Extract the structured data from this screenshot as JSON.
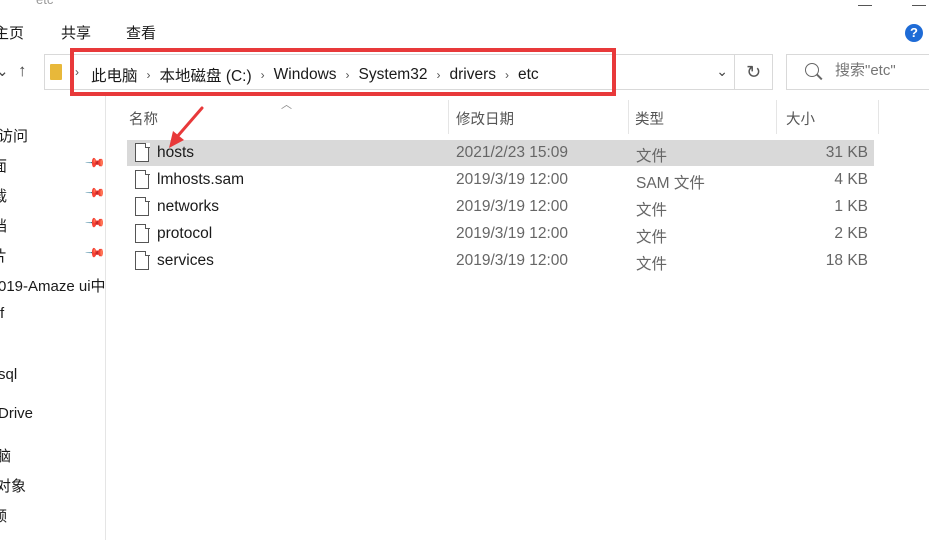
{
  "window": {
    "title": "etc"
  },
  "ribbon": {
    "tabs": [
      "主页",
      "共享",
      "查看"
    ]
  },
  "address": {
    "crumbs": [
      "此电脑",
      "本地磁盘 (C:)",
      "Windows",
      "System32",
      "drivers",
      "etc"
    ]
  },
  "search": {
    "placeholder": "搜索\"etc\""
  },
  "sidebar": {
    "items": [
      "访问",
      "面",
      "载",
      "档",
      "片",
      "019-Amaze ui中",
      "f",
      "sql",
      "Drive",
      "脑",
      "对象",
      "频"
    ]
  },
  "columns": {
    "name": "名称",
    "date": "修改日期",
    "type": "类型",
    "size": "大小"
  },
  "files": [
    {
      "name": "hosts",
      "date": "2021/2/23 15:09",
      "type": "文件",
      "size": "31 KB",
      "selected": true
    },
    {
      "name": "lmhosts.sam",
      "date": "2019/3/19 12:00",
      "type": "SAM 文件",
      "size": "4 KB",
      "selected": false
    },
    {
      "name": "networks",
      "date": "2019/3/19 12:00",
      "type": "文件",
      "size": "1 KB",
      "selected": false
    },
    {
      "name": "protocol",
      "date": "2019/3/19 12:00",
      "type": "文件",
      "size": "2 KB",
      "selected": false
    },
    {
      "name": "services",
      "date": "2019/3/19 12:00",
      "type": "文件",
      "size": "18 KB",
      "selected": false
    }
  ],
  "colors": {
    "highlight": "#e8393a",
    "selected_row": "#d9d9d9",
    "folder": "#e8b83a"
  },
  "icons": [
    "back-icon",
    "up-icon",
    "folder-icon",
    "chevron-right-icon",
    "dropdown-icon",
    "refresh-icon",
    "search-icon",
    "pin-icon",
    "file-icon",
    "red-arrow-annotation"
  ]
}
